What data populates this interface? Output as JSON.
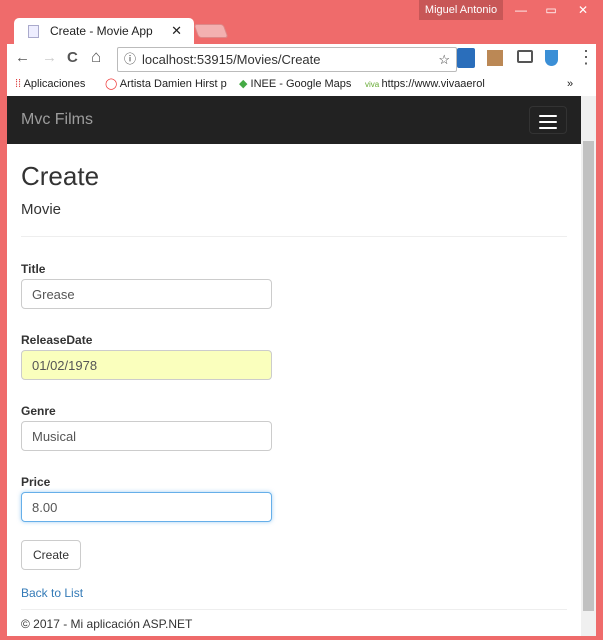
{
  "window": {
    "user": "Miguel Antonio",
    "minimize": "—",
    "maximize": "▭",
    "close": "✕"
  },
  "tab": {
    "title": "Create - Movie App",
    "close": "✕"
  },
  "toolbar": {
    "back": "←",
    "forward": "→",
    "reload": "C",
    "home": "⌂",
    "info": "ⓘ",
    "url": "localhost:53915/Movies/Create",
    "star": "☆",
    "menu": "⋮"
  },
  "bookmarks": [
    {
      "label": "Aplicaciones"
    },
    {
      "label": "Artista Damien Hirst p"
    },
    {
      "label": "INEE - Google Maps"
    },
    {
      "label": "https://www.vivaaerol"
    }
  ],
  "bookmarks_more": "»",
  "navbar": {
    "brand": "Mvc Films"
  },
  "page": {
    "title": "Create",
    "subtitle": "Movie"
  },
  "form": {
    "title": {
      "label": "Title",
      "value": "Grease"
    },
    "release": {
      "label": "ReleaseDate",
      "value": "01/02/1978"
    },
    "genre": {
      "label": "Genre",
      "value": "Musical"
    },
    "price": {
      "label": "Price",
      "value": "8.00"
    },
    "submit": "Create"
  },
  "back_link": "Back to List",
  "footer": "© 2017 - Mi aplicación ASP.NET"
}
